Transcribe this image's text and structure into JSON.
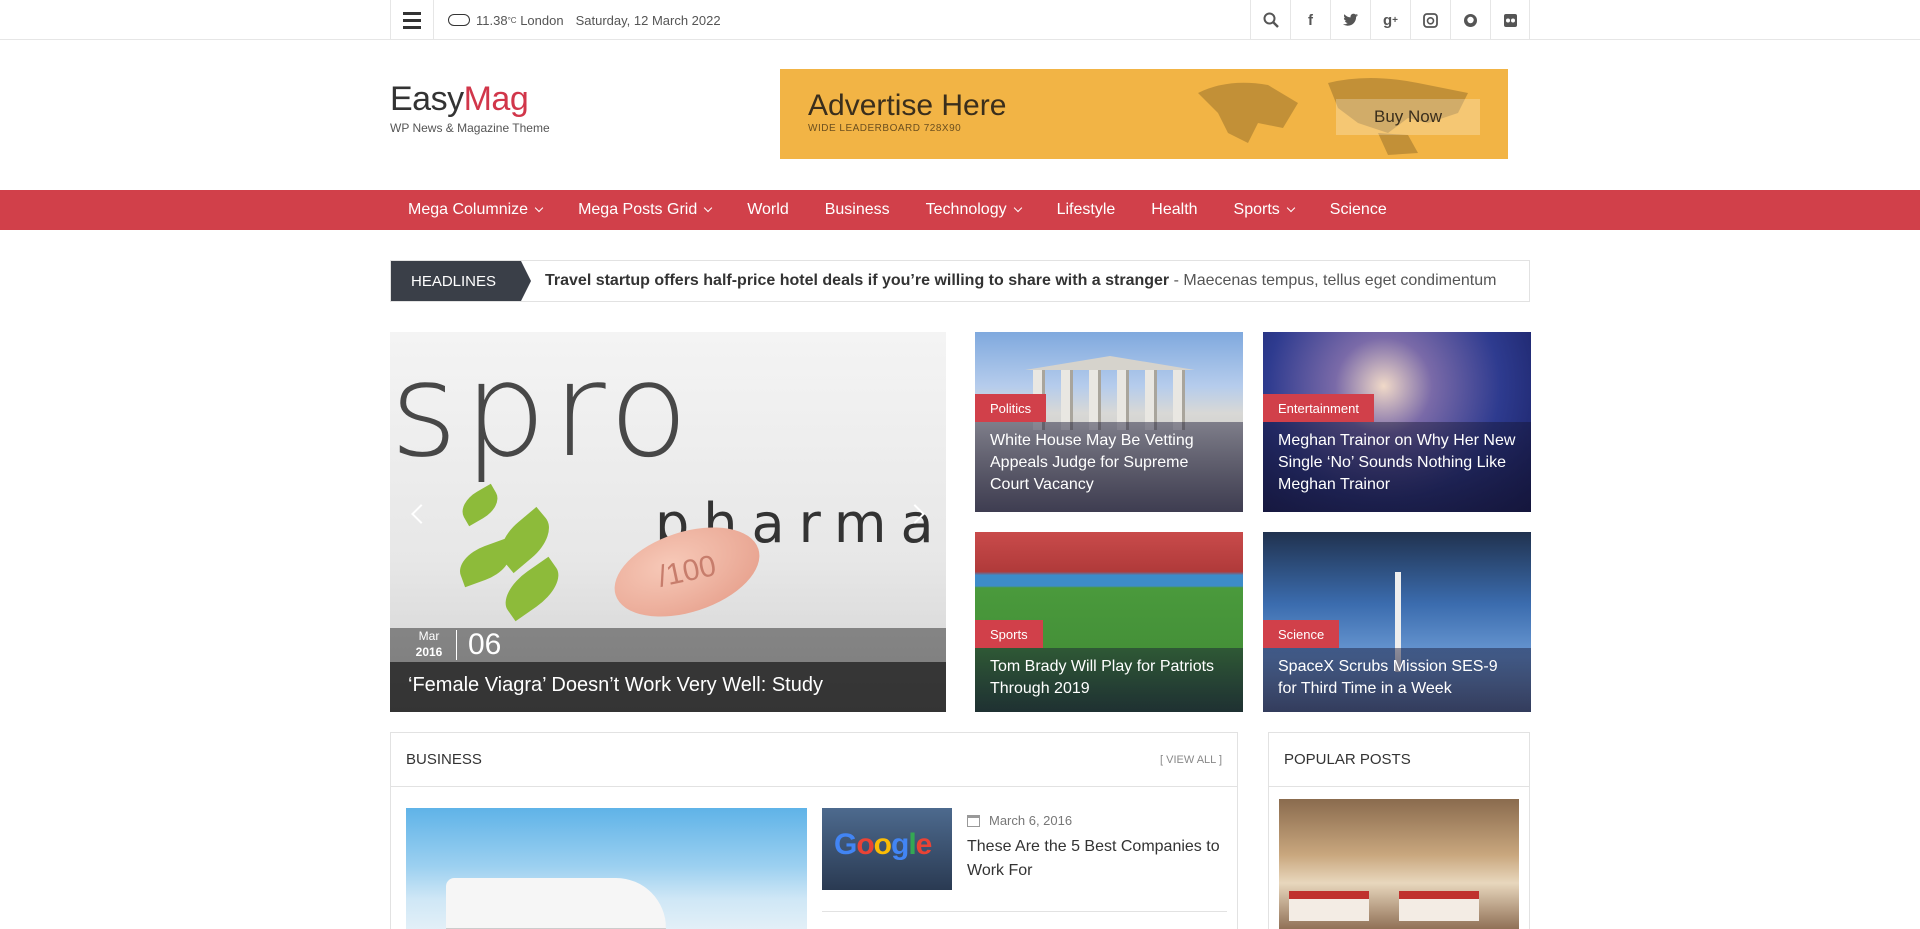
{
  "topbar": {
    "temperature": "11.38",
    "unit": "°C",
    "city": "London",
    "date": "Saturday, 12 March 2022",
    "icons": [
      "search-icon",
      "facebook-icon",
      "twitter-icon",
      "google-plus-icon",
      "instagram-icon",
      "github-icon",
      "flickr-icon"
    ]
  },
  "logo": {
    "easy": "Easy",
    "mag": "Mag",
    "tagline": "WP News & Magazine Theme"
  },
  "ad": {
    "title": "Advertise Here",
    "subtitle": "WIDE LEADERBOARD 728X90",
    "button": "Buy Now"
  },
  "nav": {
    "items": [
      {
        "label": "Mega Columnize",
        "dropdown": true
      },
      {
        "label": "Mega Posts Grid",
        "dropdown": true
      },
      {
        "label": "World",
        "dropdown": false
      },
      {
        "label": "Business",
        "dropdown": false
      },
      {
        "label": "Technology",
        "dropdown": true
      },
      {
        "label": "Lifestyle",
        "dropdown": false
      },
      {
        "label": "Health",
        "dropdown": false
      },
      {
        "label": "Sports",
        "dropdown": true
      },
      {
        "label": "Science",
        "dropdown": false
      }
    ]
  },
  "headlines": {
    "label": "HEADLINES",
    "title": "Travel startup offers half-price hotel deals if you’re willing to share with a stranger",
    "separator": " - ",
    "excerpt": "Maecenas tempus, tellus eget condimentum"
  },
  "featured": {
    "main": {
      "image_text": "spro",
      "image_text2": "pharma",
      "pill_text": "/100",
      "month": "Mar",
      "year": "2016",
      "day": "06",
      "title": "‘Female Viagra’ Doesn’t Work Very Well: Study"
    },
    "tiles": [
      {
        "category": "Politics",
        "title": "White House May Be Vetting Appeals Judge for Supreme Court Vacancy"
      },
      {
        "category": "Entertainment",
        "title": "Meghan Trainor on Why Her New Single ‘No’ Sounds Nothing Like Meghan Trainor"
      },
      {
        "category": "Sports",
        "title": "Tom Brady Will Play for Patriots Through 2019"
      },
      {
        "category": "Science",
        "title": "SpaceX Scrubs Mission SES-9 for Third Time in a Week"
      }
    ]
  },
  "business": {
    "title": "BUSINESS",
    "view_all": "[ VIEW ALL ]",
    "post": {
      "date": "March 6, 2016",
      "title": "These Are the 5 Best Companies to Work For",
      "thumb_text": "Google"
    }
  },
  "popular": {
    "title": "POPULAR POSTS"
  },
  "colors": {
    "accent": "#d1404a",
    "dark": "#3a3f48",
    "ad_bg": "#f2b445"
  }
}
